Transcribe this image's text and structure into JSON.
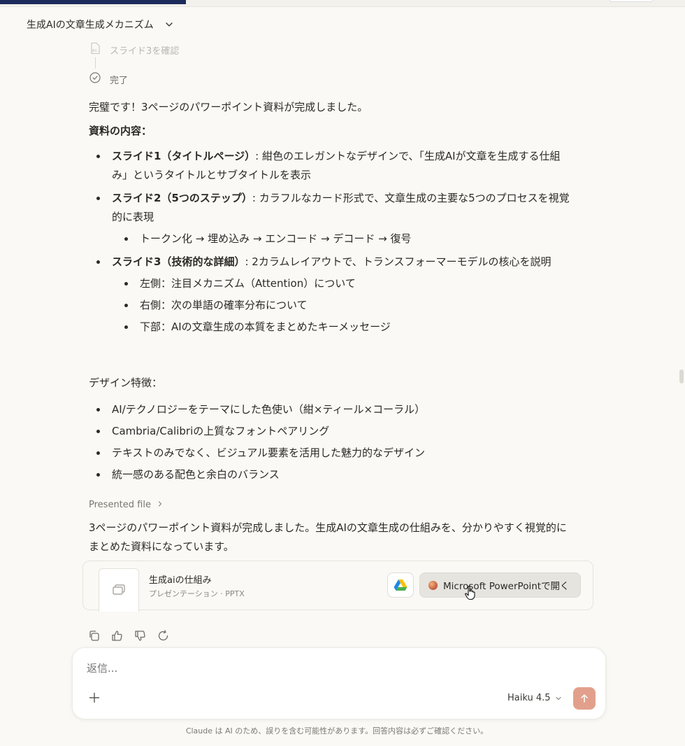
{
  "header": {
    "title": "生成AIの文章生成メカニズム",
    "chevron_icon": "chevron-down-icon"
  },
  "tools": [
    {
      "label": "スライド3を確認",
      "icon": "jpg-file-icon"
    },
    {
      "label": "完了",
      "icon": "check-circle-icon"
    }
  ],
  "message": {
    "intro": "完璧です！3ページのパワーポイント資料が完成しました。",
    "contents_heading": "資料の内容：",
    "slides": [
      {
        "title": "スライド1（タイトルページ）",
        "body": ": 紺色のエレガントなデザインで、「生成AIが文章を生成する仕組み」というタイトルとサブタイトルを表示",
        "sub": []
      },
      {
        "title": "スライド2（5つのステップ）",
        "body": ": カラフルなカード形式で、文章生成の主要な5つのプロセスを視覚的に表現",
        "sub": [
          "トークン化 → 埋め込み → エンコード → デコード → 復号"
        ]
      },
      {
        "title": "スライド3（技術的な詳細）",
        "body": ": 2カラムレイアウトで、トランスフォーマーモデルの核心を説明",
        "sub": [
          "左側：注目メカニズム（Attention）について",
          "右側：次の単語の確率分布について",
          "下部：AIの文章生成の本質をまとめたキーメッセージ"
        ]
      }
    ],
    "design_heading": "デザイン特徴：",
    "design_items": [
      "AI/テクノロジーをテーマにした色使い（紺×ティール×コーラル）",
      "Cambria/Calibriの上質なフォントペアリング",
      "テキストのみでなく、ビジュアル要素を活用した魅力的なデザイン",
      "統一感のある配色と余白のバランス"
    ],
    "presented_file_label": "Presented file",
    "closing": "3ページのパワーポイント資料が完成しました。生成AIの文章生成の仕組みを、分かりやすく視覚的にまとめた資料になっています。"
  },
  "file_card": {
    "name": "生成aiの仕組み",
    "meta": "プレゼンテーション · PPTX",
    "open_label": "Microsoft PowerPointで開く",
    "drive_icon": "google-drive-icon"
  },
  "actions": [
    "copy-icon",
    "thumbs-up-icon",
    "thumbs-down-icon",
    "retry-icon"
  ],
  "composer": {
    "placeholder": "返信...",
    "model": "Haiku 4.5",
    "send_color": "#e2a08c"
  },
  "disclaimer": "Claude は AI のため、誤りを含む可能性があります。回答内容は必ずご確認ください。"
}
